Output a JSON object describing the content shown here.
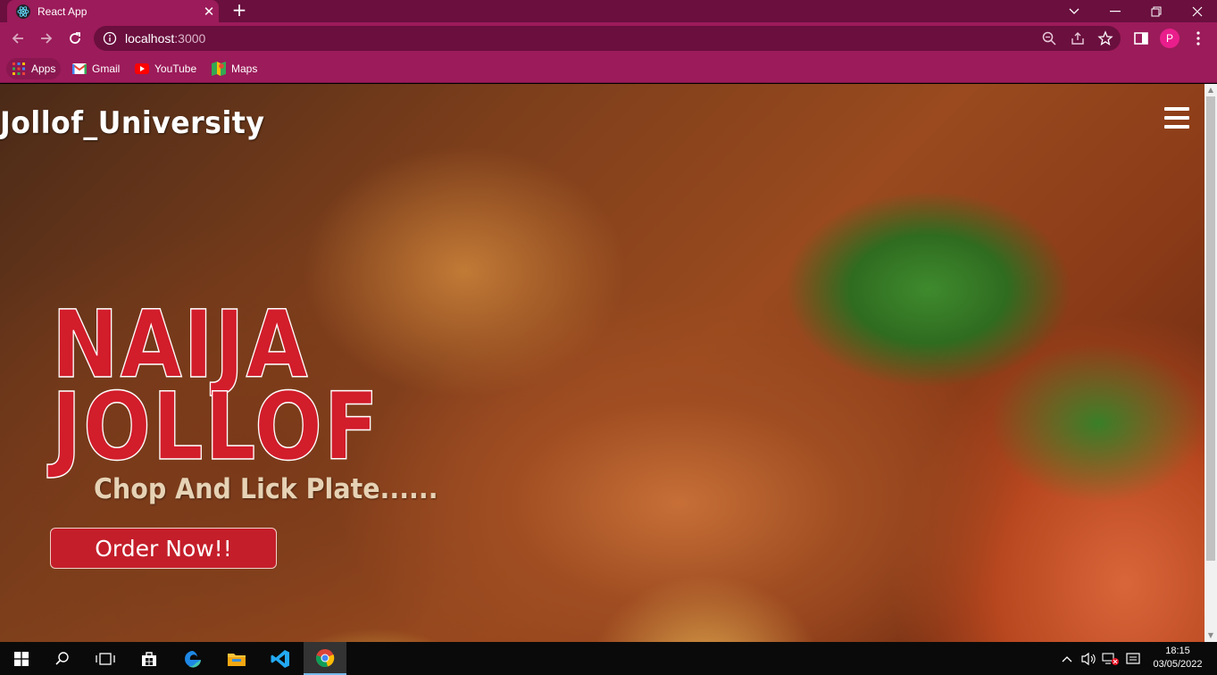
{
  "browser": {
    "tab_title": "React App",
    "tab_close": "✕",
    "new_tab": "+",
    "url_host": "localhost",
    "url_port": ":3000",
    "profile_initial": "P",
    "bookmarks": [
      {
        "label": "Apps",
        "icon": "apps-grid-icon"
      },
      {
        "label": "Gmail",
        "icon": "gmail-icon"
      },
      {
        "label": "YouTube",
        "icon": "youtube-icon"
      },
      {
        "label": "Maps",
        "icon": "maps-icon"
      }
    ]
  },
  "page": {
    "brand": "Jollof_University",
    "hero_line1": "NAIJA",
    "hero_line2": "JOLLOF",
    "tagline": "Chop And Lick Plate......",
    "order_button": "Order Now!!"
  },
  "taskbar": {
    "time": "18:15",
    "date": "03/05/2022"
  },
  "colors": {
    "chrome_dark": "#6a0f3e",
    "chrome": "#9c1b5a",
    "hero_red": "#d21d2b",
    "button_red": "#c41e2a",
    "tagline": "#e6d2b5"
  }
}
